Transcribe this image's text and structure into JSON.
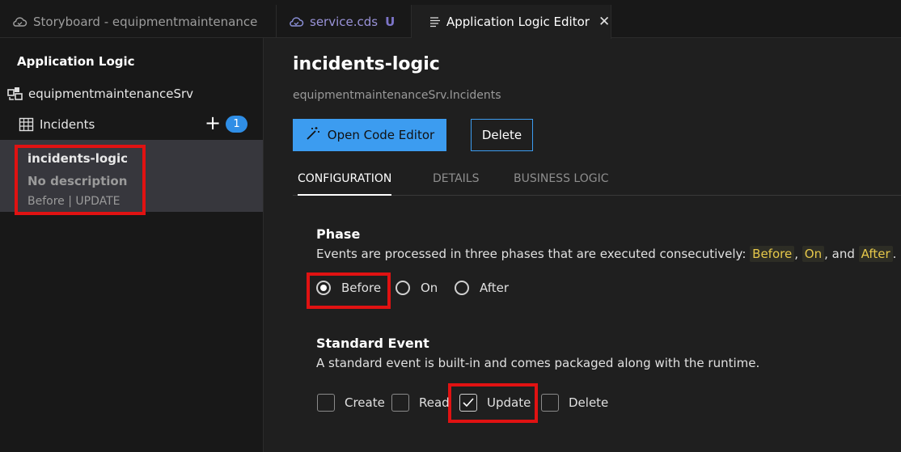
{
  "tabs": [
    {
      "label": "Storyboard - equipmentmaintenance",
      "icon": "cloud-icon"
    },
    {
      "label": "service.cds",
      "badge": "U",
      "icon": "cloud-icon"
    },
    {
      "label": "Application Logic Editor",
      "icon": "lines-icon",
      "close": "✕"
    }
  ],
  "sidebar": {
    "title": "Application Logic",
    "service": "equipmentmaintenanceSrv",
    "entity": {
      "label": "Incidents",
      "add": "+",
      "count": "1"
    },
    "item": {
      "name": "incidents-logic",
      "description": "No description",
      "meta": "Before | UPDATE"
    }
  },
  "main": {
    "title": "incidents-logic",
    "subtitle": "equipmentmaintenanceSrv.Incidents",
    "open_code_editor": "Open Code Editor",
    "delete": "Delete",
    "tabs": [
      "CONFIGURATION",
      "DETAILS",
      "BUSINESS LOGIC"
    ],
    "active_tab": "CONFIGURATION",
    "phase": {
      "title": "Phase",
      "desc_start": "Events are processed in three phases that are executed consecutively: ",
      "hl1": "Before",
      "sep1": ",",
      "hl2": "On",
      "sep2": ", and",
      "hl3": "After",
      "end": ".",
      "options": [
        "Before",
        "On",
        "After"
      ],
      "selected": "Before"
    },
    "standard_event": {
      "title": "Standard Event",
      "desc": "A standard event is built-in and comes packaged along with the runtime.",
      "options": [
        "Create",
        "Read",
        "Update",
        "Delete"
      ],
      "checked": [
        "Update"
      ]
    }
  },
  "colors": {
    "accent": "#3c9cf0",
    "highlight_box": "#e01212",
    "badge": "#2f8ee6"
  }
}
